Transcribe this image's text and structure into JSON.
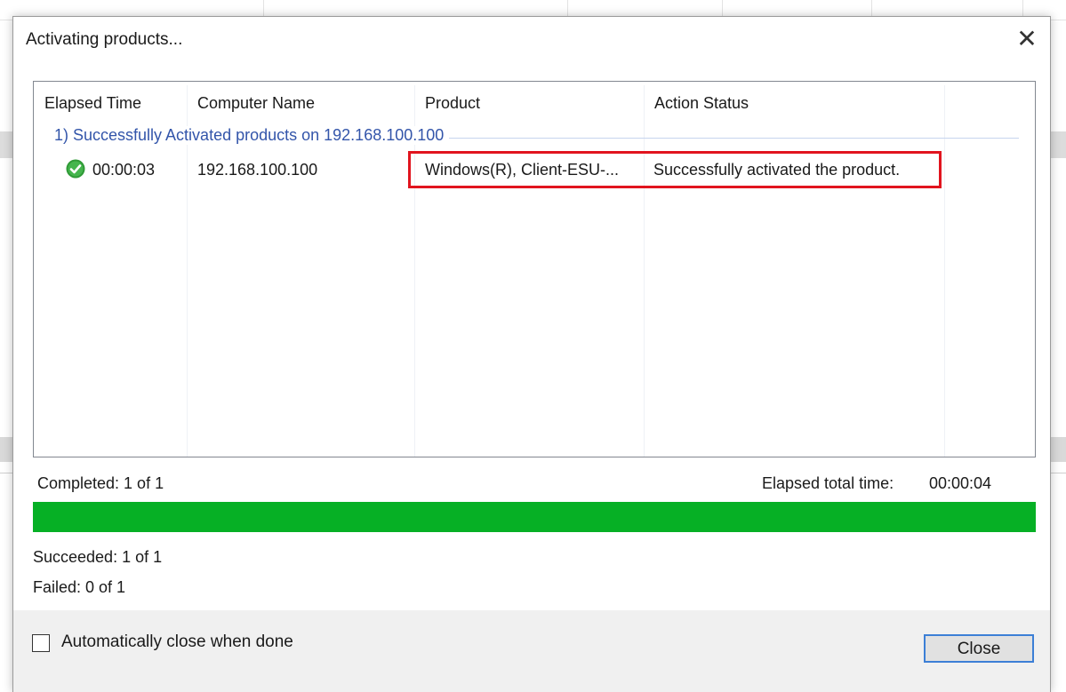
{
  "dialog": {
    "title": "Activating products...",
    "close_glyph": "✕"
  },
  "list": {
    "columns": [
      "Elapsed Time",
      "Computer Name",
      "Product",
      "Action Status"
    ],
    "group_label": "1) Successfully Activated products on 192.168.100.100",
    "rows": [
      {
        "status_icon": "success-check-icon",
        "elapsed": "00:00:03",
        "computer": "192.168.100.100",
        "product": "Windows(R), Client-ESU-...",
        "action_status": "Successfully activated the product."
      }
    ]
  },
  "summary": {
    "completed": "Completed: 1 of 1",
    "elapsed_label": "Elapsed total time:",
    "elapsed_value": "00:00:04",
    "progress_fraction": 1.0,
    "succeeded": "Succeeded: 1 of 1",
    "failed": "Failed: 0 of 1"
  },
  "footer": {
    "auto_close_label": "Automatically close when done",
    "auto_close_checked": false,
    "close_button": "Close"
  },
  "colors": {
    "progress_green": "#06b025",
    "highlight_red": "#e1141e",
    "group_text_blue": "#3355aa",
    "button_focus_blue": "#3c7fd6"
  }
}
